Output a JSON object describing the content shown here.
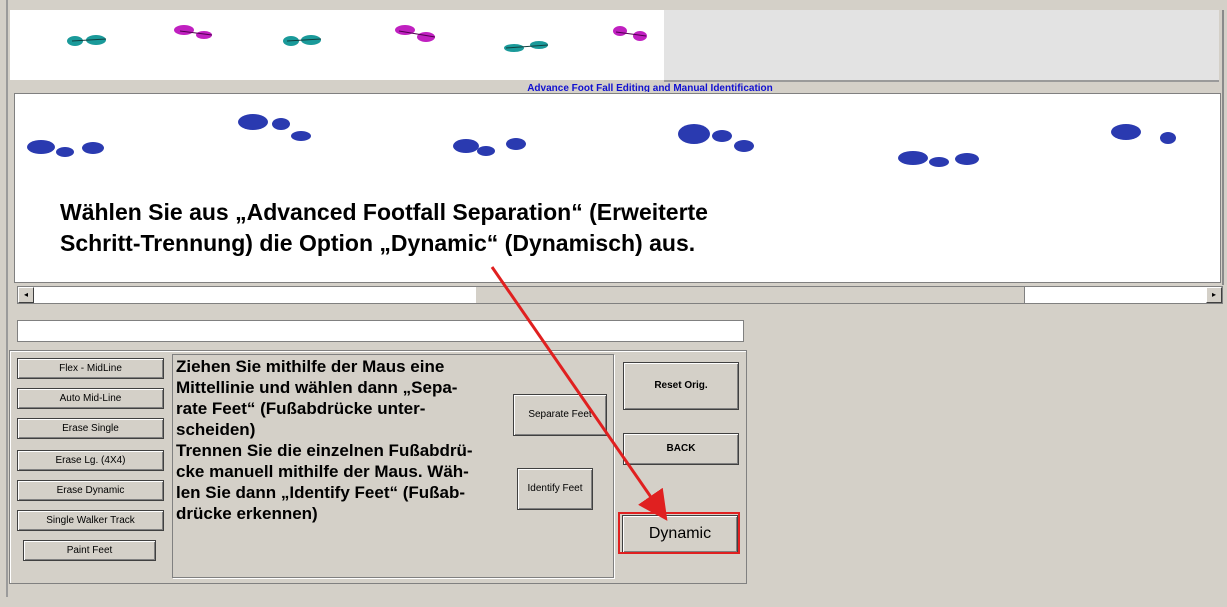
{
  "section_title": "Advance Foot Fall Editing and Manual Identification",
  "instruction_main": {
    "line1": "Wählen Sie aus „Advanced Footfall Separation“ (Erweiterte",
    "line2": "Schritt-Trennung) die Option „Dynamic“ (Dynamisch) aus."
  },
  "scrollbar": {
    "left_arrow": "◂",
    "right_arrow": "▸"
  },
  "tool_buttons": [
    "Flex - MidLine",
    "Auto Mid-Line",
    "Erase Single",
    "Erase Lg. (4X4)",
    "Erase Dynamic",
    "Single Walker Track",
    "Paint Feet"
  ],
  "separate_feet_label": "Separate Feet",
  "identify_feet_label": "Identify Feet",
  "reset_label": "Reset Orig.",
  "back_label": "BACK",
  "dynamic_label": "Dynamic",
  "group_instruction": {
    "l1": "Ziehen Sie mithilfe der Maus eine",
    "l2": "Mittellinie und wählen dann „Sepa-",
    "l3": "rate Feet“ (Fußabdrücke unter-",
    "l4": "scheiden)",
    "l5": "Trennen Sie die einzelnen Fußabdrü-",
    "l6": "cke manuell mithilfe der Maus. Wäh-",
    "l7": "len Sie dann „Identify Feet“ (Fußab-",
    "l8": "drücke erkennen)"
  },
  "colors": {
    "teal_foot": "#1a9a9a",
    "magenta_foot": "#c020c0",
    "blue_foot": "#2a3ab0",
    "arrow": "#e02020",
    "highlight": "#e02020",
    "title_link": "#1010d0"
  },
  "icons": {
    "top_footprints": [
      "teal",
      "magenta",
      "teal",
      "magenta",
      "teal",
      "magenta"
    ],
    "canvas_footprints": [
      "blue",
      "blue",
      "blue",
      "blue",
      "blue",
      "blue"
    ]
  }
}
